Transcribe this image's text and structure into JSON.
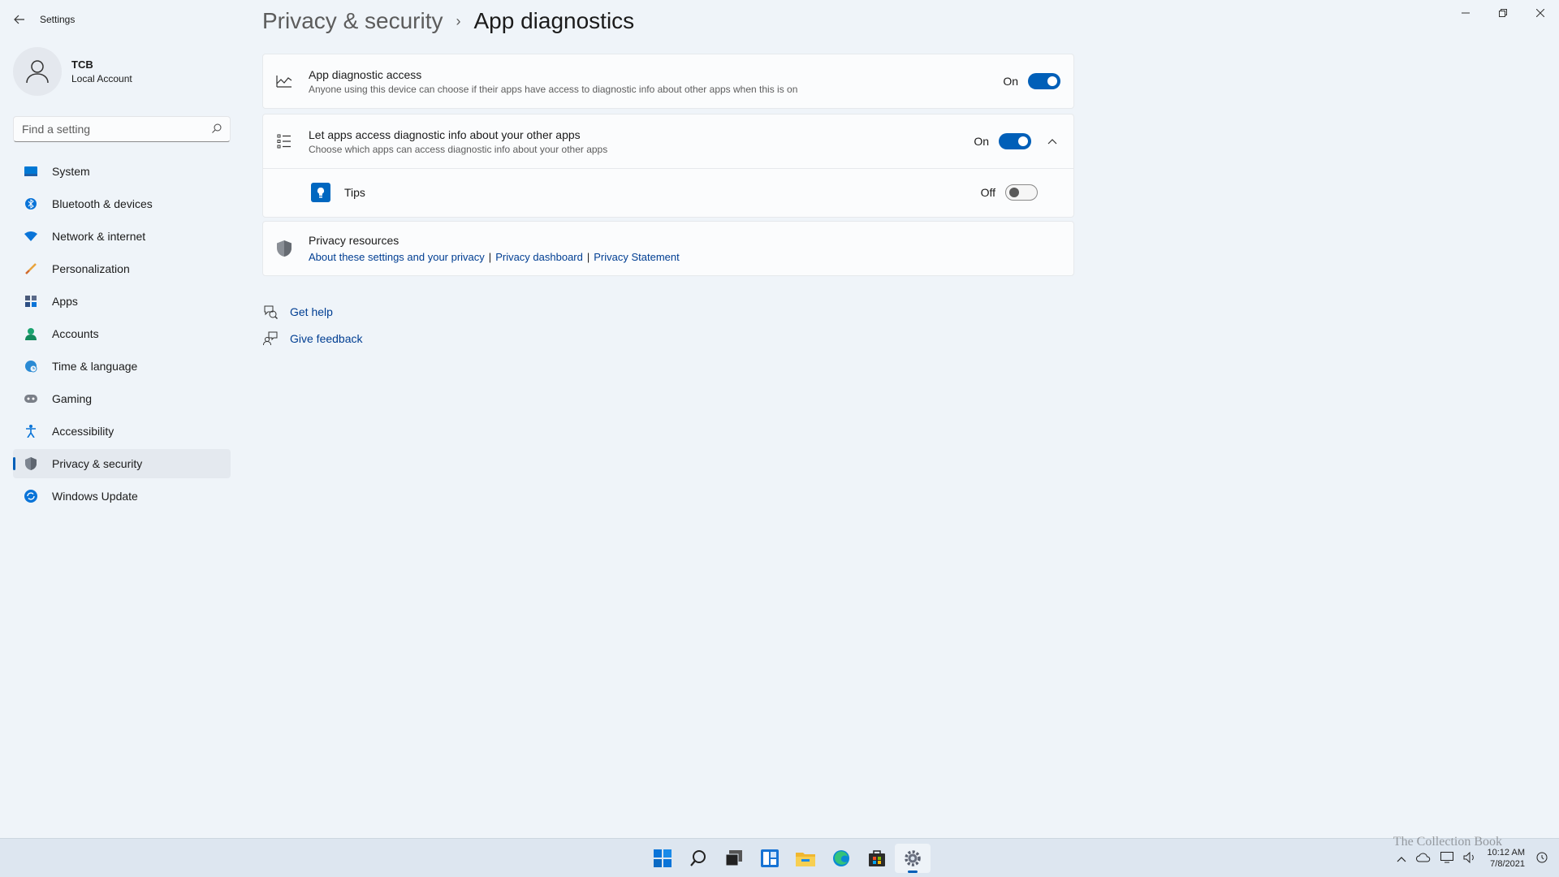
{
  "window": {
    "title": "Settings",
    "minimize_icon": "minimize-icon",
    "maximize_icon": "restore-icon",
    "close_icon": "close-icon"
  },
  "user": {
    "name": "TCB",
    "type": "Local Account"
  },
  "search": {
    "placeholder": "Find a setting"
  },
  "sidebar": {
    "items": [
      {
        "label": "System",
        "icon": "monitor-icon"
      },
      {
        "label": "Bluetooth & devices",
        "icon": "bluetooth-icon"
      },
      {
        "label": "Network & internet",
        "icon": "wifi-icon"
      },
      {
        "label": "Personalization",
        "icon": "brush-icon"
      },
      {
        "label": "Apps",
        "icon": "apps-icon"
      },
      {
        "label": "Accounts",
        "icon": "person-icon"
      },
      {
        "label": "Time & language",
        "icon": "globe-clock-icon"
      },
      {
        "label": "Gaming",
        "icon": "gamepad-icon"
      },
      {
        "label": "Accessibility",
        "icon": "accessibility-icon"
      },
      {
        "label": "Privacy & security",
        "icon": "shield-icon",
        "active": true
      },
      {
        "label": "Windows Update",
        "icon": "update-icon"
      }
    ]
  },
  "breadcrumb": {
    "parent": "Privacy & security",
    "separator": "›",
    "current": "App diagnostics"
  },
  "settings": {
    "app_diag": {
      "title": "App diagnostic access",
      "desc": "Anyone using this device can choose if their apps have access to diagnostic info about other apps when this is on",
      "state": "On"
    },
    "let_apps": {
      "title": "Let apps access diagnostic info about your other apps",
      "desc": "Choose which apps can access diagnostic info about your other apps",
      "state": "On"
    },
    "tips": {
      "title": "Tips",
      "state": "Off"
    }
  },
  "privacy_resources": {
    "title": "Privacy resources",
    "link1": "About these settings and your privacy",
    "link2": "Privacy dashboard",
    "link3": "Privacy Statement",
    "sep": "|"
  },
  "help": {
    "get_help": "Get help",
    "give_feedback": "Give feedback"
  },
  "taskbar": {
    "time": "10:12 AM",
    "date": "7/8/2021",
    "watermark": "The Collection Book"
  },
  "colors": {
    "accent": "#005fb8",
    "link": "#003e92",
    "background": "#eff4f9"
  }
}
